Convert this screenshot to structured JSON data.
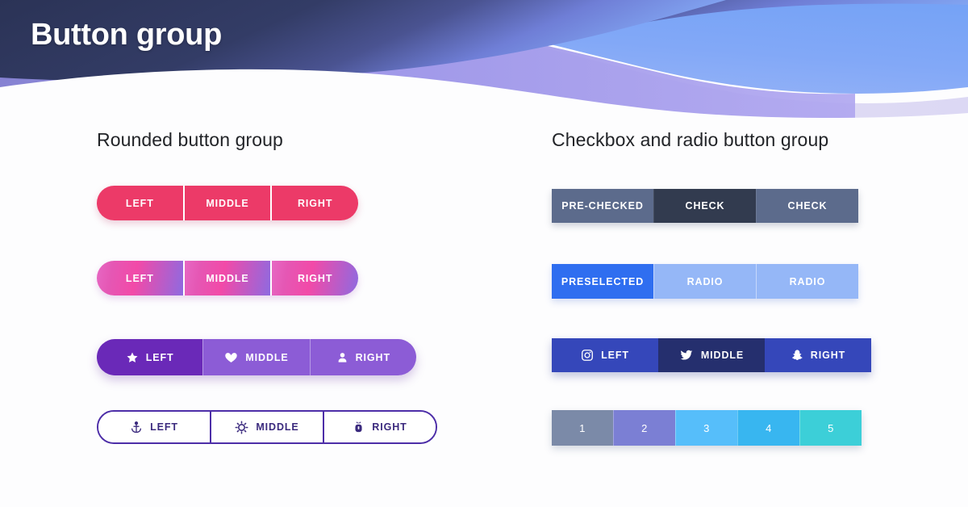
{
  "header": {
    "title": "Button group",
    "bg_dark": "#2b3356",
    "bg_blue": "#7ba6f5",
    "bg_purple": "#8f8ae0",
    "bg_lavender": "#e6e3f7"
  },
  "left_column": {
    "section_title": "Rounded button group",
    "groups": {
      "pink": {
        "name": "solid-pink-group",
        "color": "#ec3a68",
        "segments": [
          {
            "label": "LEFT"
          },
          {
            "label": "MIDDLE"
          },
          {
            "label": "RIGHT"
          }
        ]
      },
      "gradient": {
        "name": "gradient-group",
        "color_start": "#ee5ab8",
        "color_end": "#8e6ae0",
        "segments": [
          {
            "label": "LEFT"
          },
          {
            "label": "MIDDLE"
          },
          {
            "label": "RIGHT"
          }
        ]
      },
      "purple_icons": {
        "name": "purple-icon-group",
        "color": "#8c5cd6",
        "color_active": "#6a29b8",
        "segments": [
          {
            "label": "LEFT",
            "icon": "star-icon",
            "active": true
          },
          {
            "label": "MIDDLE",
            "icon": "heart-icon",
            "active": false
          },
          {
            "label": "RIGHT",
            "icon": "user-icon",
            "active": false
          }
        ]
      },
      "outline_icons": {
        "name": "outline-icon-group",
        "border_color": "#4d2ea8",
        "text_color": "#3b2a7e",
        "segments": [
          {
            "label": "LEFT",
            "icon": "anchor-icon"
          },
          {
            "label": "MIDDLE",
            "icon": "gear-icon"
          },
          {
            "label": "RIGHT",
            "icon": "bug-icon"
          }
        ]
      }
    }
  },
  "right_column": {
    "section_title": "Checkbox and radio button group",
    "groups": {
      "checkbox": {
        "name": "checkbox-group",
        "color": "#5c6b8c",
        "color_active": "#323b4f",
        "segments": [
          {
            "label": "PRE-CHECKED",
            "state": "checked"
          },
          {
            "label": "CHECK",
            "state": "active"
          },
          {
            "label": "CHECK",
            "state": "default"
          }
        ]
      },
      "radio": {
        "name": "radio-group",
        "color": "#95b7f7",
        "color_selected": "#2f6ef0",
        "segments": [
          {
            "label": "PRESELECTED",
            "state": "selected"
          },
          {
            "label": "RADIO",
            "state": "default"
          },
          {
            "label": "RADIO",
            "state": "default"
          }
        ]
      },
      "social": {
        "name": "social-group",
        "color": "#3547ba",
        "color_active": "#252f6e",
        "segments": [
          {
            "label": "LEFT",
            "icon": "instagram-icon",
            "active": false
          },
          {
            "label": "MIDDLE",
            "icon": "twitter-icon",
            "active": true
          },
          {
            "label": "RIGHT",
            "icon": "snapchat-icon",
            "active": false
          }
        ]
      },
      "scale": {
        "name": "numeric-scale-group",
        "segments": [
          {
            "label": "1",
            "color": "#7b8aa8"
          },
          {
            "label": "2",
            "color": "#7b7fd4"
          },
          {
            "label": "3",
            "color": "#56befa"
          },
          {
            "label": "4",
            "color": "#38b6f0"
          },
          {
            "label": "5",
            "color": "#3ccfd8"
          }
        ]
      }
    }
  }
}
